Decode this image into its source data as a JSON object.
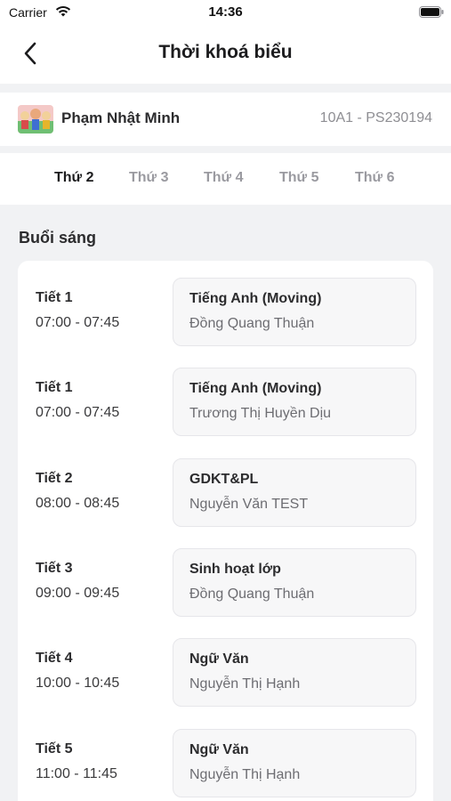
{
  "status_bar": {
    "carrier": "Carrier",
    "time": "14:36"
  },
  "nav": {
    "title": "Thời khoá biểu",
    "back_icon": "chevron-left-icon"
  },
  "student": {
    "name": "Phạm Nhật Minh",
    "class_code": "10A1 - PS230194"
  },
  "tabs": [
    {
      "label": "Thứ 2",
      "active": true
    },
    {
      "label": "Thứ 3",
      "active": false
    },
    {
      "label": "Thứ 4",
      "active": false
    },
    {
      "label": "Thứ 5",
      "active": false
    },
    {
      "label": "Thứ 6",
      "active": false
    }
  ],
  "morning": {
    "title": "Buổi sáng",
    "periods": [
      {
        "period": "Tiết 1",
        "time": "07:00 - 07:45",
        "subject": "Tiếng Anh (Moving)",
        "teacher": "Đồng Quang Thuận"
      },
      {
        "period": "Tiết 1",
        "time": "07:00 - 07:45",
        "subject": "Tiếng Anh (Moving)",
        "teacher": "Trương Thị Huyền Dịu"
      },
      {
        "period": "Tiết 2",
        "time": "08:00 - 08:45",
        "subject": "GDKT&PL",
        "teacher": "Nguyễn Văn TEST"
      },
      {
        "period": "Tiết 3",
        "time": "09:00 - 09:45",
        "subject": "Sinh hoạt lớp",
        "teacher": "Đồng Quang Thuận"
      },
      {
        "period": "Tiết 4",
        "time": "10:00 - 10:45",
        "subject": "Ngữ Văn",
        "teacher": "Nguyễn Thị Hạnh"
      },
      {
        "period": "Tiết 5",
        "time": "11:00 - 11:45",
        "subject": "Ngữ Văn",
        "teacher": "Nguyễn Thị Hạnh"
      }
    ]
  }
}
